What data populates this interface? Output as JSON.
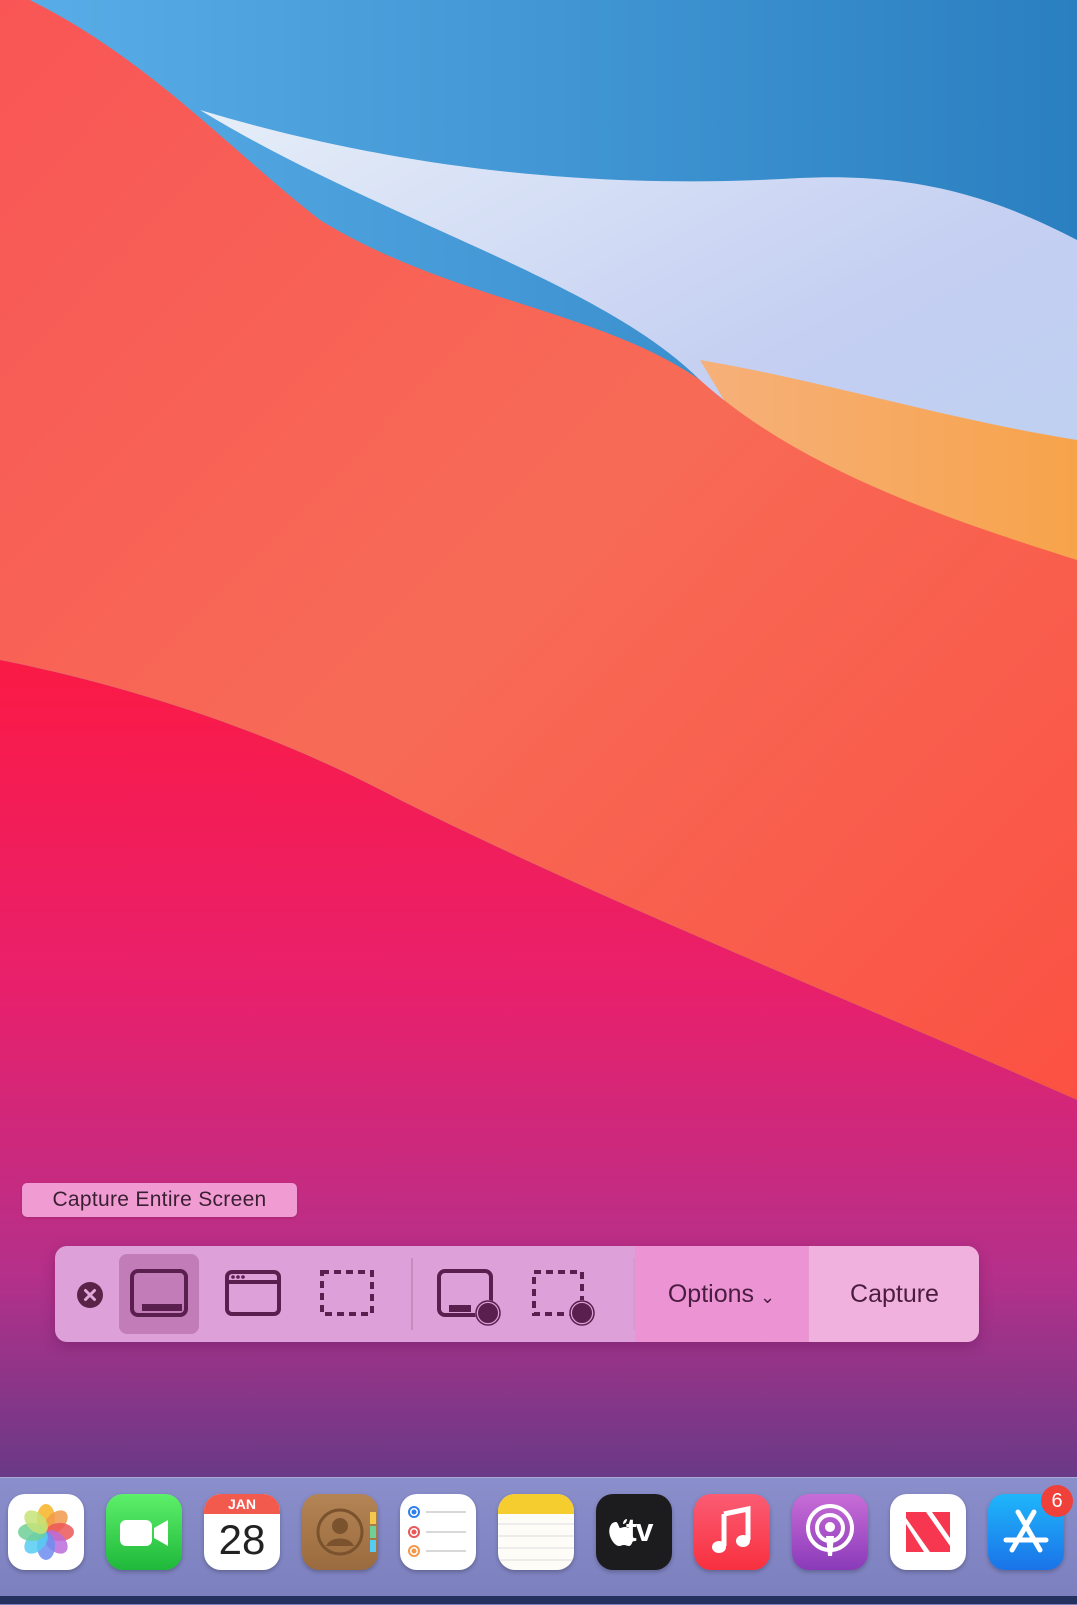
{
  "tooltip": {
    "text": "Capture Entire Screen"
  },
  "toolbar": {
    "close_icon": "close-x-circle-icon",
    "buttons": [
      {
        "name": "capture-entire-screen",
        "icon": "screen-icon",
        "selected": true
      },
      {
        "name": "capture-window",
        "icon": "window-icon",
        "selected": false
      },
      {
        "name": "capture-selection",
        "icon": "dashed-rect-icon",
        "selected": false
      },
      {
        "name": "record-entire-screen",
        "icon": "screen-record-icon",
        "selected": false
      },
      {
        "name": "record-selection",
        "icon": "dashed-rect-record-icon",
        "selected": false
      }
    ],
    "options_label": "Options",
    "options_chevron": "⌄",
    "capture_label": "Capture"
  },
  "dock": {
    "apps": [
      {
        "name": "Photos",
        "icon": "photos-icon"
      },
      {
        "name": "FaceTime",
        "icon": "facetime-icon"
      },
      {
        "name": "Calendar",
        "icon": "calendar-icon",
        "month": "JAN",
        "day": "28"
      },
      {
        "name": "Contacts",
        "icon": "contacts-icon"
      },
      {
        "name": "Reminders",
        "icon": "reminders-icon"
      },
      {
        "name": "Notes",
        "icon": "notes-icon"
      },
      {
        "name": "Apple TV",
        "icon": "apple-tv-icon",
        "label": "tv"
      },
      {
        "name": "Music",
        "icon": "music-icon"
      },
      {
        "name": "Podcasts",
        "icon": "podcasts-icon"
      },
      {
        "name": "News",
        "icon": "news-icon"
      },
      {
        "name": "App Store",
        "icon": "app-store-icon",
        "badge": "6"
      }
    ]
  },
  "colors": {
    "toolbar_bg": "#dea0d8",
    "options_bg": "#ec93d3",
    "capture_bg": "#f1b1df",
    "tooltip_bg": "#f09bd2",
    "badge": "#f0403a"
  }
}
